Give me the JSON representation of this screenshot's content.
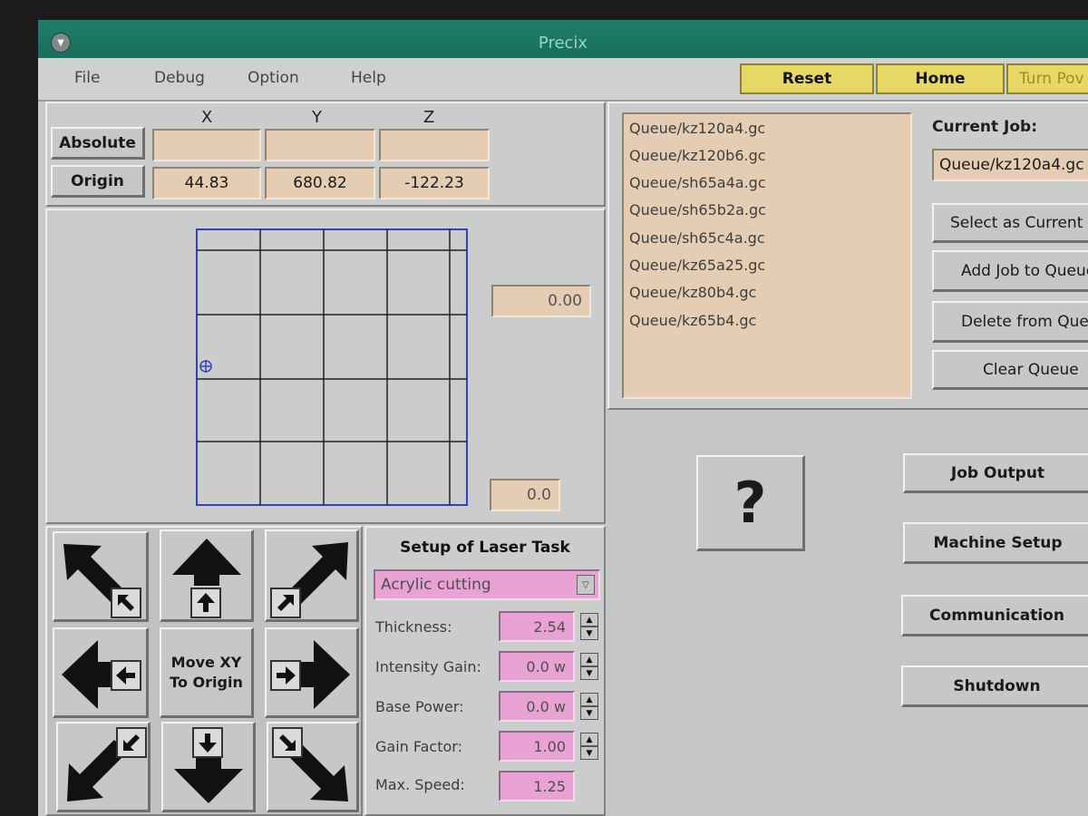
{
  "window": {
    "title": "Precix"
  },
  "menu": {
    "file": "File",
    "debug": "Debug",
    "option": "Option",
    "help": "Help"
  },
  "top_buttons": {
    "reset": "Reset",
    "home": "Home",
    "turn_power": "Turn Pov"
  },
  "coords": {
    "x_header": "X",
    "y_header": "Y",
    "z_header": "Z",
    "absolute_label": "Absolute",
    "origin_label": "Origin",
    "absolute_x": "",
    "absolute_y": "",
    "absolute_z": "",
    "origin_x": "44.83",
    "origin_y": "680.82",
    "origin_z": "-122.23"
  },
  "plot": {
    "field_top": "0.00",
    "field_bottom": "0.0"
  },
  "jog": {
    "center_line1": "Move XY",
    "center_line2": "To Origin"
  },
  "laser_setup": {
    "title": "Setup of Laser Task",
    "material": "Acrylic cutting",
    "thickness_label": "Thickness:",
    "thickness": "2.54",
    "intensity_label": "Intensity Gain:",
    "intensity": "0.0 w",
    "base_label": "Base Power:",
    "base": "0.0 w",
    "gain_label": "Gain Factor:",
    "gain": "1.00",
    "speed_label": "Max. Speed:",
    "speed": "1.25"
  },
  "queue": {
    "items": [
      "Queue/kz120a4.gc",
      "Queue/kz120b6.gc",
      "Queue/sh65a4a.gc",
      "Queue/sh65b2a.gc",
      "Queue/sh65c4a.gc",
      "Queue/kz65a25.gc",
      "Queue/kz80b4.gc",
      "Queue/kz65b4.gc"
    ],
    "current_job_label": "Current Job:",
    "current_job": "Queue/kz120a4.gc",
    "select_current": "Select as Current",
    "add_job": "Add Job to Queue",
    "delete_job": "Delete from Queue",
    "clear_queue": "Clear Queue"
  },
  "help_button": "?",
  "side_buttons": {
    "job_output": "Job Output",
    "machine_setup": "Machine Setup",
    "communication": "Communication",
    "shutdown": "Shutdown"
  }
}
